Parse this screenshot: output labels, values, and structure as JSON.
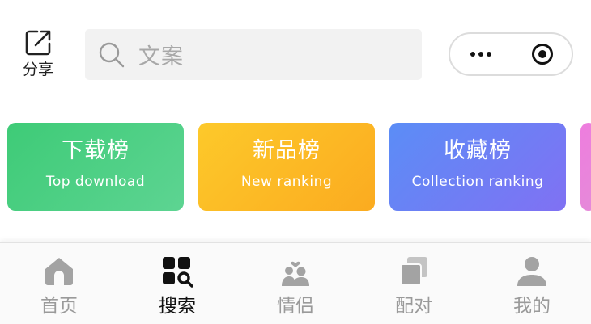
{
  "header": {
    "share_label": "分享",
    "search_placeholder": "文案"
  },
  "capsule": {
    "more_icon": "more-dots-icon",
    "close_icon": "target-circle-icon"
  },
  "rankings": [
    {
      "title": "下载榜",
      "subtitle": "Top download",
      "color_start": "#3ecb77",
      "color_end": "#5dd492"
    },
    {
      "title": "新品榜",
      "subtitle": "New ranking",
      "color_start": "#fdc92a",
      "color_end": "#fbab20"
    },
    {
      "title": "收藏榜",
      "subtitle": "Collection ranking",
      "color_start": "#5b8df6",
      "color_end": "#8071f3"
    }
  ],
  "tabbar": {
    "active_tab": "搜索",
    "tabs": [
      {
        "label": "首页",
        "icon": "home-icon"
      },
      {
        "label": "搜索",
        "icon": "search-grid-icon"
      },
      {
        "label": "情侣",
        "icon": "couple-icon"
      },
      {
        "label": "配对",
        "icon": "pair-cards-icon"
      },
      {
        "label": "我的",
        "icon": "profile-icon"
      }
    ]
  },
  "colors": {
    "active_tab": "#111111",
    "inactive_tab": "#9a9a9a",
    "search_bg": "#f2f2f2"
  }
}
